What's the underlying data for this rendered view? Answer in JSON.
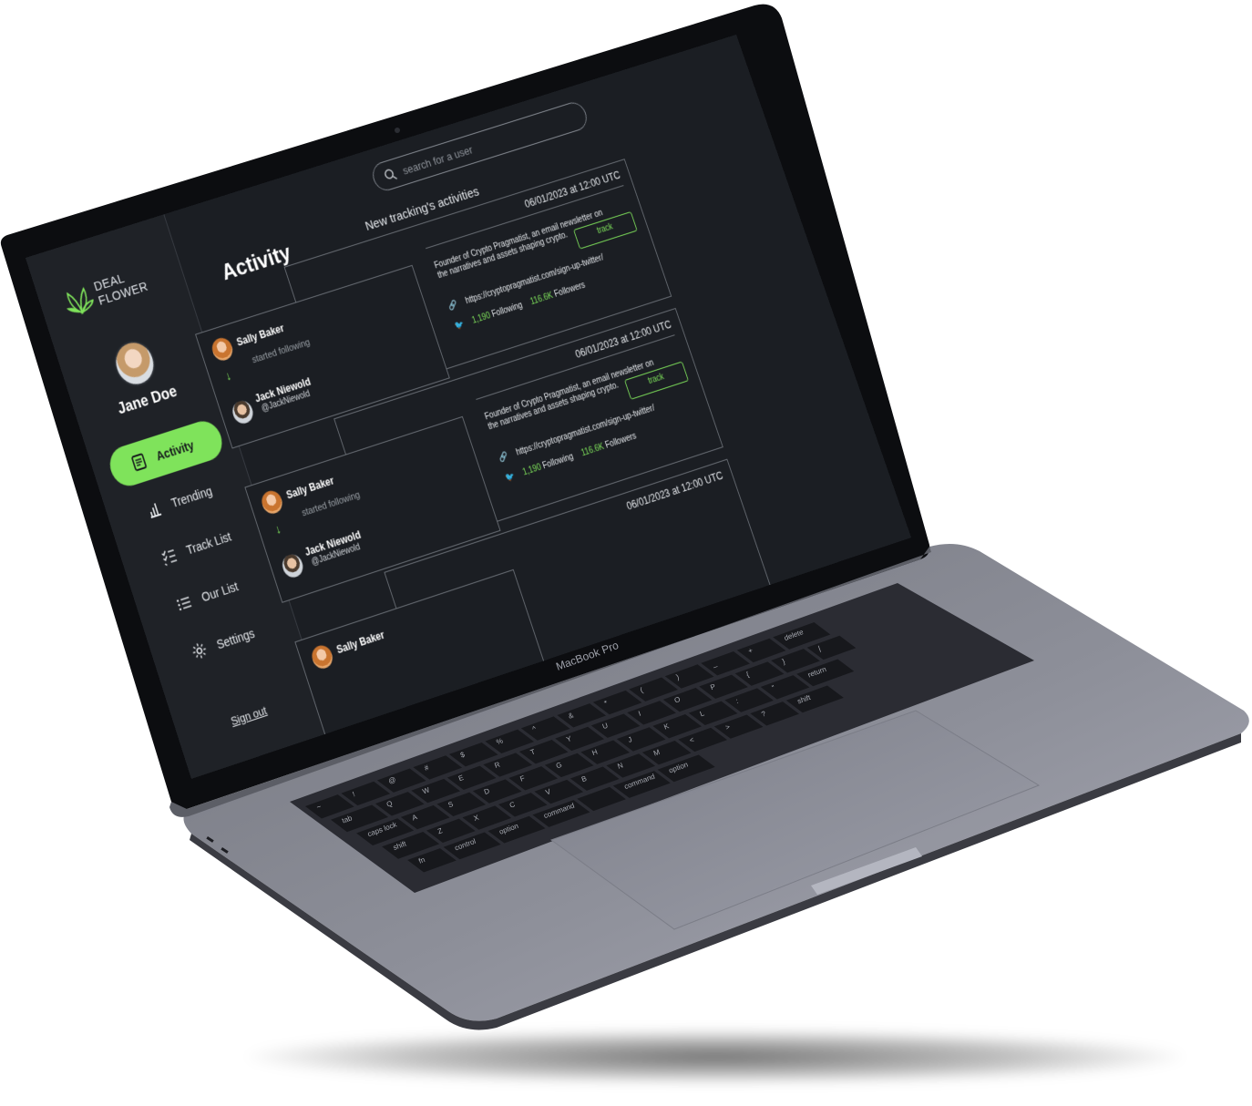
{
  "brand": {
    "line1": "DEAL",
    "line2": "FLOWER"
  },
  "user": {
    "name": "Jane Doe"
  },
  "nav": [
    {
      "label": "Activity",
      "icon": "document-icon",
      "active": true
    },
    {
      "label": "Trending",
      "icon": "bar-chart-icon",
      "active": false
    },
    {
      "label": "Track List",
      "icon": "checklist-icon",
      "active": false
    },
    {
      "label": "Our List",
      "icon": "list-icon",
      "active": false
    },
    {
      "label": "Settings",
      "icon": "gear-icon",
      "active": false
    }
  ],
  "sign_out": "Sign out",
  "search": {
    "placeholder": "search for a user"
  },
  "page_title": "Activity",
  "section_title": "New tracking's activities",
  "activities": [
    {
      "timestamp": "06/01/2023 at 12:00 UTC",
      "actor": "Sally Baker",
      "action": "started following",
      "target_name": "Jack Niewold",
      "target_handle": "@JackNiewold",
      "bio": "Founder of Crypto Pragmatist, an email newsletter on the narratives and assets shaping crypto.",
      "link": "https://cryptopragmatist.com/sign-up-twitter/",
      "following": "1,190",
      "following_label": "Following",
      "followers": "116.6K",
      "followers_label": "Followers",
      "track_label": "track"
    },
    {
      "timestamp": "06/01/2023 at 12:00 UTC",
      "actor": "Sally Baker",
      "action": "started following",
      "target_name": "Jack Niewold",
      "target_handle": "@JackNiewold",
      "bio": "Founder of Crypto Pragmatist, an email newsletter on the narratives and assets shaping crypto.",
      "link": "https://cryptopragmatist.com/sign-up-twitter/",
      "following": "1,190",
      "following_label": "Following",
      "followers": "116.6K",
      "followers_label": "Followers",
      "track_label": "track"
    },
    {
      "timestamp": "06/01/2023 at 12:00 UTC",
      "actor": "Sally Baker"
    }
  ],
  "device_label": "MacBook Pro",
  "keys": {
    "row1": [
      "~",
      "!",
      "@",
      "#",
      "$",
      "%",
      "^",
      "&",
      "*",
      "(",
      ")",
      "_",
      "+",
      "delete"
    ],
    "row2": [
      "tab",
      "Q",
      "W",
      "E",
      "R",
      "T",
      "Y",
      "U",
      "I",
      "O",
      "P",
      "{",
      "}",
      "|"
    ],
    "row3": [
      "caps lock",
      "A",
      "S",
      "D",
      "F",
      "G",
      "H",
      "J",
      "K",
      "L",
      ":",
      "\"",
      "return"
    ],
    "row4": [
      "shift",
      "Z",
      "X",
      "C",
      "V",
      "B",
      "N",
      "M",
      "<",
      ">",
      "?",
      "shift"
    ],
    "row5": [
      "fn",
      "control",
      "option",
      "command",
      "",
      "command",
      "option"
    ]
  },
  "colors": {
    "accent": "#7fe35b",
    "screen_bg": "#1b1e23",
    "body": "#6e7079"
  }
}
